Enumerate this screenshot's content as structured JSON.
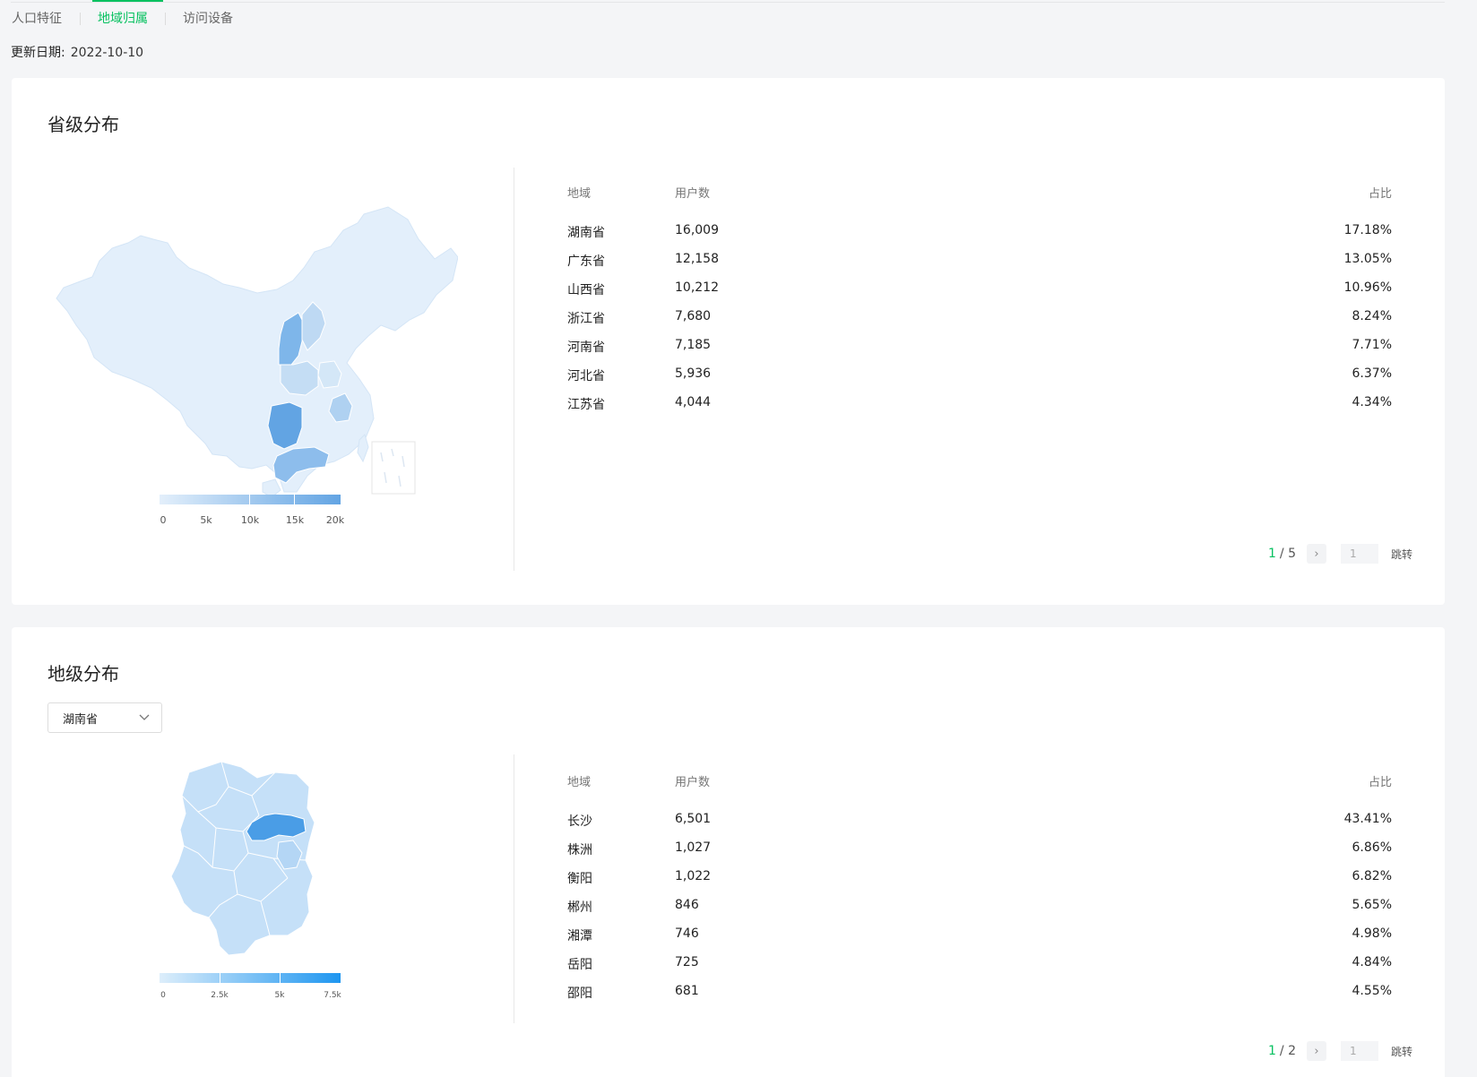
{
  "tabs": [
    {
      "label": "人口特征",
      "active": false
    },
    {
      "label": "地域归属",
      "active": true
    },
    {
      "label": "访问设备",
      "active": false
    }
  ],
  "update": {
    "label": "更新日期:",
    "value": "2022-10-10"
  },
  "colors": {
    "accent": "#07c160",
    "map_light": "#e3effb",
    "map_dark": "#62a4e3",
    "city_light": "#c5e0f8",
    "city_dark": "#4a9de6"
  },
  "province": {
    "title": "省级分布",
    "legend": {
      "labels": [
        "0",
        "5k",
        "10k",
        "15k",
        "20k"
      ],
      "min": 0,
      "max": 20000
    },
    "table": {
      "headers": {
        "region": "地域",
        "users": "用户数",
        "pct": "占比"
      },
      "rows": [
        {
          "region": "湖南省",
          "users": "16,009",
          "pct": "17.18%"
        },
        {
          "region": "广东省",
          "users": "12,158",
          "pct": "13.05%"
        },
        {
          "region": "山西省",
          "users": "10,212",
          "pct": "10.96%"
        },
        {
          "region": "浙江省",
          "users": "7,680",
          "pct": "8.24%"
        },
        {
          "region": "河南省",
          "users": "7,185",
          "pct": "7.71%"
        },
        {
          "region": "河北省",
          "users": "5,936",
          "pct": "6.37%"
        },
        {
          "region": "江苏省",
          "users": "4,044",
          "pct": "4.34%"
        }
      ]
    },
    "pager": {
      "current": "1",
      "total": "/ 5",
      "input": "1",
      "jump": "跳转"
    }
  },
  "city": {
    "title": "地级分布",
    "select": {
      "value": "湖南省"
    },
    "legend": {
      "labels": [
        "0",
        "2.5k",
        "5k",
        "7.5k"
      ],
      "min": 0,
      "max": 7500
    },
    "table": {
      "headers": {
        "region": "地域",
        "users": "用户数",
        "pct": "占比"
      },
      "rows": [
        {
          "region": "长沙",
          "users": "6,501",
          "pct": "43.41%"
        },
        {
          "region": "株洲",
          "users": "1,027",
          "pct": "6.86%"
        },
        {
          "region": "衡阳",
          "users": "1,022",
          "pct": "6.82%"
        },
        {
          "region": "郴州",
          "users": "846",
          "pct": "5.65%"
        },
        {
          "region": "湘潭",
          "users": "746",
          "pct": "4.98%"
        },
        {
          "region": "岳阳",
          "users": "725",
          "pct": "4.84%"
        },
        {
          "region": "邵阳",
          "users": "681",
          "pct": "4.55%"
        }
      ]
    },
    "pager": {
      "current": "1",
      "total": "/ 2",
      "input": "1",
      "jump": "跳转"
    }
  }
}
